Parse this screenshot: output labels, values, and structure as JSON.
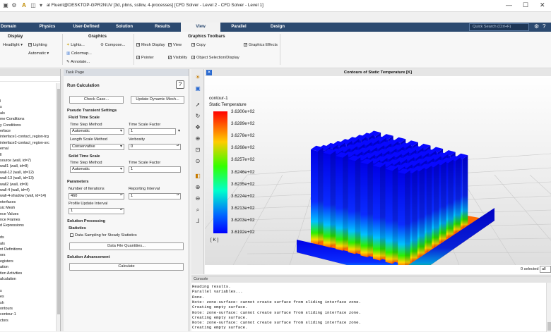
{
  "window": {
    "title": "al Fluent@DESKTOP-GPR2NUV [3d, pbns, sstkw, 4-processes] [CFD Solver - Level 2 - CFD Solver - Level 1]",
    "min": "—",
    "max": "☐",
    "close": "✕"
  },
  "ribbon_tabs": [
    {
      "label": "Domain"
    },
    {
      "label": "Physics"
    },
    {
      "label": "User-Defined"
    },
    {
      "label": "Solution"
    },
    {
      "label": "Results"
    },
    {
      "label": "View"
    },
    {
      "label": "Parallel"
    },
    {
      "label": "Design"
    }
  ],
  "active_tab": "View",
  "search_placeholder": "Quick Search (Ctrl+F)",
  "ribbon": {
    "display": {
      "title": "Display",
      "headlight": "Headlight",
      "lighting": "Lighting",
      "automatic": "Automatic"
    },
    "graphics": {
      "title": "Graphics",
      "lights": "Lights...",
      "colormap": "Colormap...",
      "annotate": "Annotate...",
      "compose": "Compose..."
    },
    "graphics_toolbars": {
      "title": "Graphics Toolbars",
      "mesh_display": "Mesh Display",
      "view": "View",
      "copy": "Copy",
      "graphics_effects": "Graphics Effects",
      "pointer": "Pointer",
      "visibility": "Visibility",
      "object_selection": "Object Selection/Display"
    }
  },
  "tree_items": [
    "l",
    "s",
    "als",
    "me Conditions",
    "y Conditions",
    "erface",
    "interface1-contact_region-trg",
    "interface2-contact_region-src",
    "ernal",
    "ll",
    "source (wall, id=7)",
    "wall1 (wall, id=8)",
    "wall-12 (wall, id=12)",
    "wall-13 (wall, id=13)",
    "wall2 (wall, id=9)",
    "wall-4 (wall, id=4)",
    "wall-4-shadow (wall, id=14)",
    "nterfaces",
    "sic Mesh",
    "nce Values",
    "nce Frames",
    "d Expressions",
    "",
    "ds",
    "als",
    "nt Definitions",
    "ors",
    "egisters",
    "ation",
    "tion Activities",
    "alculation",
    "",
    "s",
    "es",
    "sh",
    "ontours",
    "contour-1",
    "ctors"
  ],
  "task_page": {
    "header": "Task Page",
    "title": "Run Calculation",
    "check_case": "Check Case...",
    "update_dynamic_mesh": "Update Dynamic Mesh...",
    "pseudo_transient": "Pseudo Transient Settings",
    "fluid_time_scale": "Fluid Time Scale",
    "time_step_method_label": "Time Step Method",
    "time_step_method_value": "Automatic",
    "time_scale_factor_label": "Time Scale Factor",
    "time_scale_factor_value": "1",
    "length_scale_method_label": "Length Scale Method",
    "length_scale_method_value": "Conservative",
    "verbosity_label": "Verbosity",
    "verbosity_value": "0",
    "solid_time_scale": "Solid Time Scale",
    "solid_time_step_method_value": "Automatic",
    "solid_time_scale_factor_value": "1",
    "parameters": "Parameters",
    "num_iterations_label": "Number of Iterations",
    "num_iterations_value": "460",
    "reporting_interval_label": "Reporting Interval",
    "reporting_interval_value": "1",
    "profile_update_label": "Profile Update Interval",
    "profile_update_value": "1",
    "solution_processing": "Solution Processing",
    "statistics": "Statistics",
    "data_sampling": "Data Sampling for Steady Statistics",
    "data_file_quantities": "Data File Quantities...",
    "solution_advancement": "Solution Advancement",
    "calculate": "Calculate"
  },
  "graphics": {
    "title": "Contours of Static Temperature [K]",
    "contour_name": "contour-1",
    "quantity": "Static Temperature",
    "unit": "[ K ]",
    "legend_values": [
      "3.6300e+02",
      "3.6289e+02",
      "3.6278e+02",
      "3.6268e+02",
      "3.6257e+02",
      "3.6246e+02",
      "3.6235e+02",
      "3.6224e+02",
      "3.6213e+02",
      "3.6203e+02",
      "3.6192e+02"
    ]
  },
  "status_bar": {
    "selected": "0 selected",
    "filter": "all"
  },
  "console": {
    "header": "Console",
    "lines": [
      "  Reading results.",
      "Parallel variables...",
      "Done.",
      "Note: zone-surface: cannot create surface from sliding interface zone.",
      "Creating empty surface.",
      "Note: zone-surface: cannot create surface from sliding interface zone.",
      "Creating empty surface.",
      "Note: zone-surface: cannot create surface from sliding interface zone.",
      "Creating empty surface."
    ]
  }
}
